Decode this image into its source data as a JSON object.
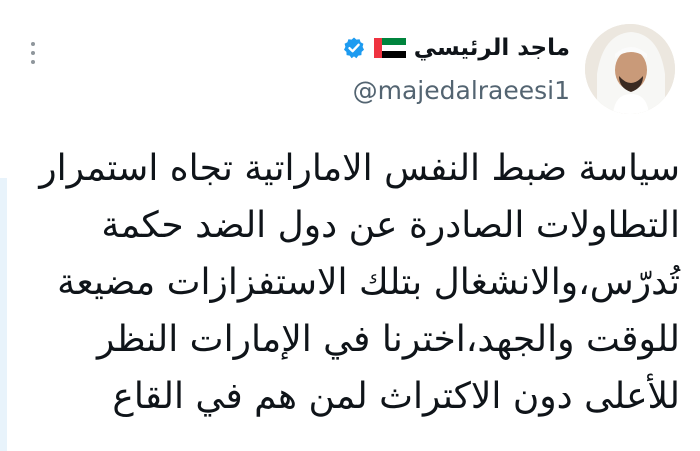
{
  "tweet": {
    "author_name": "ماجد الرئيسي",
    "handle": "@majedalraeesi1",
    "icons": {
      "more": "more-options-icon",
      "flag": "uae-flag-icon",
      "verified": "verified-badge-icon"
    },
    "colors": {
      "verified": "#1d9bf0",
      "handle": "#536471",
      "text": "#0f1419",
      "flag_red": "#ef3340",
      "flag_green": "#00843d",
      "flag_black": "#000000"
    },
    "body_lines": [
      "سياسة ضبط النفس الاماراتية تجاه استمرار",
      "التطاولات الصادرة عن دول الضد حكمة",
      "تُدرّس،والانشغال بتلك الاستفزازات مضيعة",
      "للوقت والجهد،اخترنا في الإمارات النظر",
      "للأعلى دون الاكتراث لمن هم في القاع"
    ]
  }
}
